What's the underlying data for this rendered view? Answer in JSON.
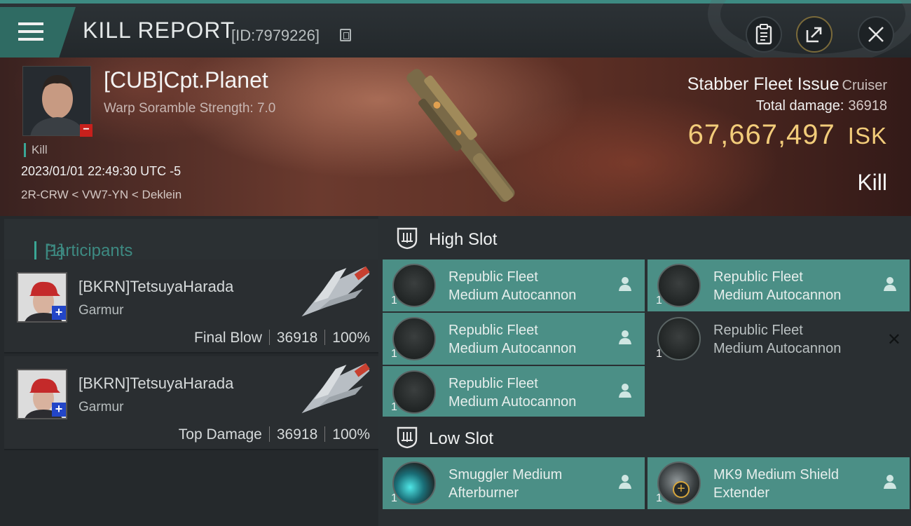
{
  "header": {
    "title": "KILL REPORT",
    "report_id": "[ID:7979226]",
    "icons": [
      "menu-icon",
      "copy-icon",
      "clipboard-icon",
      "share-icon",
      "close-icon"
    ]
  },
  "victim": {
    "name": "[CUB]Cpt.Planet",
    "subtitle": "Warp Soramble Strength: 7.0",
    "tag": "Kill",
    "datetime": "2023/01/01 22:49:30 UTC -5",
    "location": "2R-CRW < VW7-YN < Deklein",
    "ship_name": "Stabber Fleet Issue",
    "ship_class": "Cruiser",
    "total_damage_label": "Total damage:",
    "total_damage": "36918",
    "isk_value": "67,667,497",
    "isk_unit": "ISK",
    "result": "Kill"
  },
  "participants": {
    "label": "Participants",
    "count": "[1]",
    "rows": [
      {
        "name": "[BKRN]TetsuyaHarada",
        "ship": "Garmur",
        "role": "Final Blow",
        "damage": "36918",
        "percent": "100%"
      },
      {
        "name": "[BKRN]TetsuyaHarada",
        "ship": "Garmur",
        "role": "Top Damage",
        "damage": "36918",
        "percent": "100%"
      }
    ]
  },
  "fitting": {
    "high_slot": {
      "label": "High Slot",
      "modules": [
        {
          "line1": "Republic Fleet",
          "line2": "Medium Autocannon",
          "qty": "1"
        },
        {
          "line1": "Republic Fleet",
          "line2": "Medium Autocannon",
          "qty": "1"
        },
        {
          "line1": "Republic Fleet",
          "line2": "Medium Autocannon",
          "qty": "1"
        },
        {
          "line1": "Republic Fleet",
          "line2": "Medium Autocannon",
          "qty": "1"
        },
        {
          "line1": "Republic Fleet",
          "line2": "Medium Autocannon",
          "qty": "1"
        }
      ]
    },
    "low_slot": {
      "label": "Low Slot",
      "modules": [
        {
          "line1": "Smuggler Medium",
          "line2": "Afterburner",
          "qty": "1"
        },
        {
          "line1": "MK9 Medium Shield",
          "line2": "Extender",
          "qty": "1"
        }
      ]
    }
  },
  "colors": {
    "accent_teal": "#4b8f86",
    "isk_gold": "#f2cc7a",
    "header_teal": "#2f6b63"
  }
}
